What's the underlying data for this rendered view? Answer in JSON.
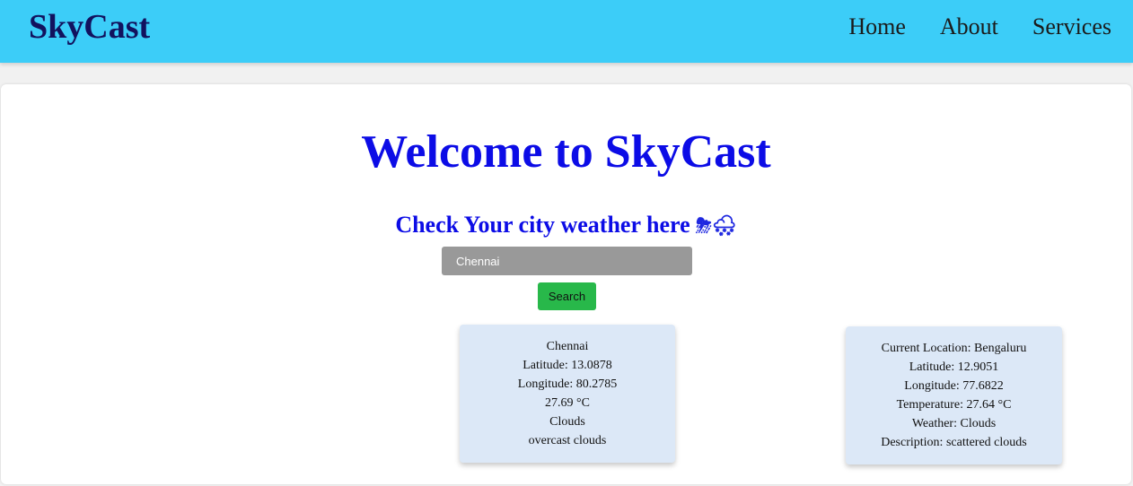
{
  "navbar": {
    "brand": "SkyCast",
    "links": [
      {
        "label": "Home"
      },
      {
        "label": "About"
      },
      {
        "label": "Services"
      }
    ],
    "background_color": "#3ccdf8",
    "brand_color": "#12125e"
  },
  "hero": {
    "title": "Welcome to SkyCast",
    "subtitle": "Check Your city weather here",
    "subtitle_icons": [
      "⛈",
      "🌨"
    ],
    "accent_color": "#0c0ce6"
  },
  "search": {
    "value": "Chennai",
    "button_label": "Search",
    "input_color": "#999999",
    "button_color": "#28b84a"
  },
  "search_result": {
    "city": "Chennai",
    "latitude": "Latitude: 13.0878",
    "longitude": "Longitude: 80.2785",
    "temperature": "27.69 °C",
    "weather": "Clouds",
    "description": "overcast clouds"
  },
  "current_location": {
    "location": "Current Location: Bengaluru",
    "latitude": "Latitude: 12.9051",
    "longitude": "Longitude: 77.6822",
    "temperature": "Temperature: 27.64 °C",
    "weather": "Weather: Clouds",
    "description": "Description: scattered clouds"
  },
  "card_color": "#dce8f7"
}
